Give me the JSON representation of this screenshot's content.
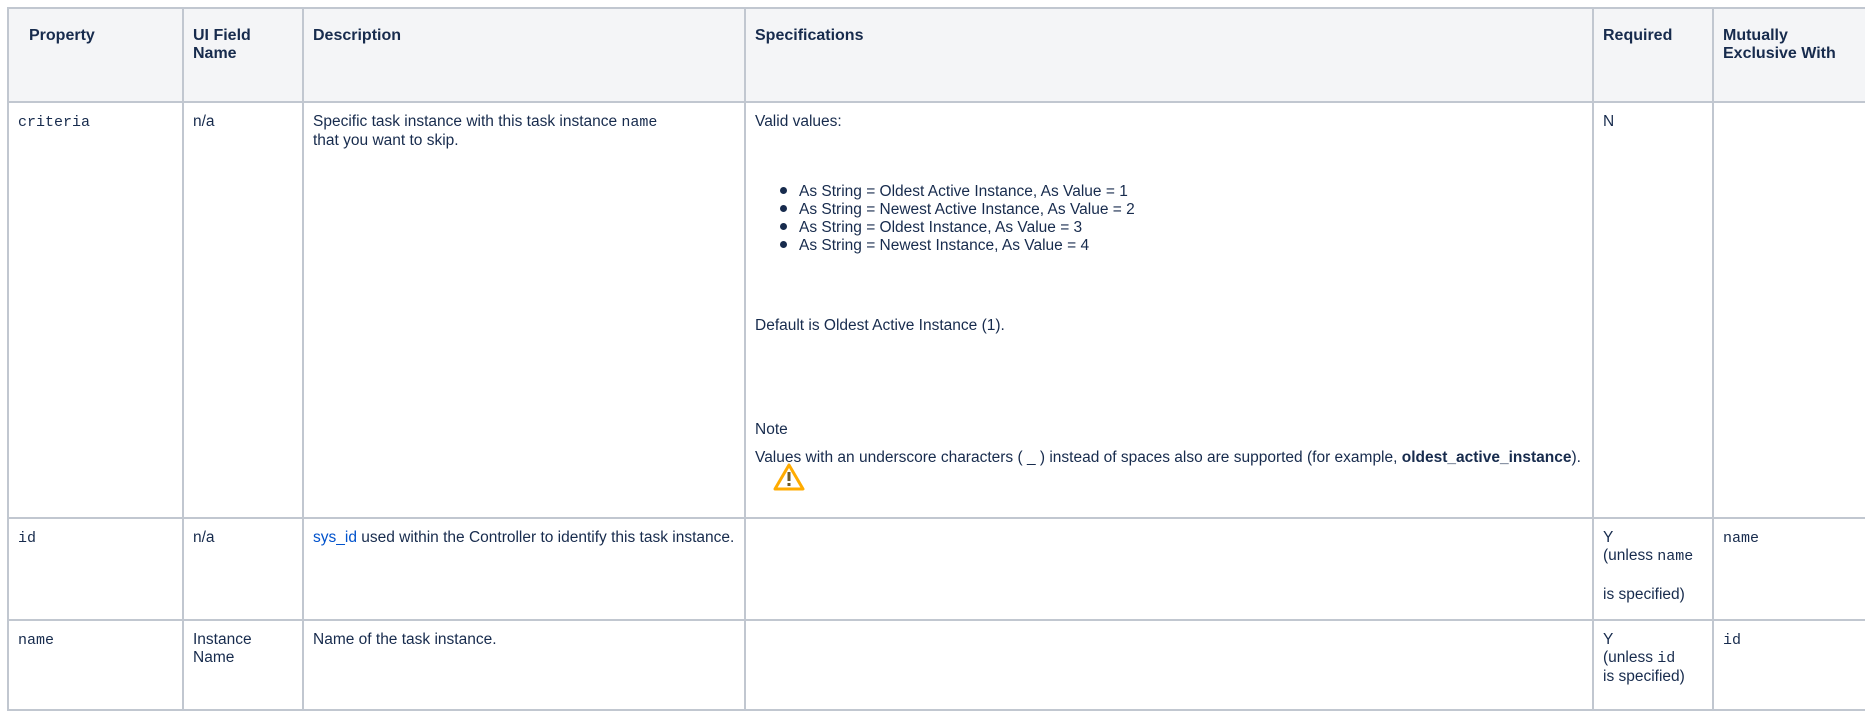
{
  "headers": [
    "Property",
    "UI Field Name",
    "Description",
    "Specifications",
    "Required",
    "Mutually Exclusive With"
  ],
  "rows": {
    "criteria": {
      "property": "criteria",
      "ui_field": "n/a",
      "description_before": "Specific task instance with this task instance ",
      "description_code": "name",
      "description_after": "that you want to skip.",
      "spec_intro": "Valid values:",
      "valid_values": [
        "As String = Oldest Active Instance, As Value = 1",
        "As String = Newest Active Instance, As Value = 2",
        "As String = Oldest Instance, As Value = 3",
        "As String = Newest Instance, As Value = 4"
      ],
      "default_text": "Default is Oldest Active Instance (1).",
      "note_title": "Note",
      "note_text": "Values with an underscore characters ( _ ) instead of spaces also are supported (for example, ",
      "note_bold": "oldest_active_instance",
      "note_end": ").",
      "required": "N",
      "mutually_exclusive": ""
    },
    "id": {
      "property": "id",
      "ui_field": "n/a",
      "description_link": "sys_id",
      "description_after": " used within the Controller to identify this task instance.",
      "required_y": "Y",
      "required_unless": "(unless ",
      "required_code": "name",
      "required_end": "is specified)",
      "mutually_exclusive": "name"
    },
    "name": {
      "property": "name",
      "ui_field": "Instance Name",
      "description": "Name of the task instance.",
      "required_y": "Y",
      "required_unless": "(unless ",
      "required_code": "id",
      "required_end": "is specified)",
      "mutually_exclusive": "id"
    }
  },
  "icons": {
    "note": "warning-icon"
  },
  "colors": {
    "header_bg": "#f4f5f7",
    "border": "#c1c7d0",
    "link": "#0052cc",
    "warning": "#ffab00"
  }
}
